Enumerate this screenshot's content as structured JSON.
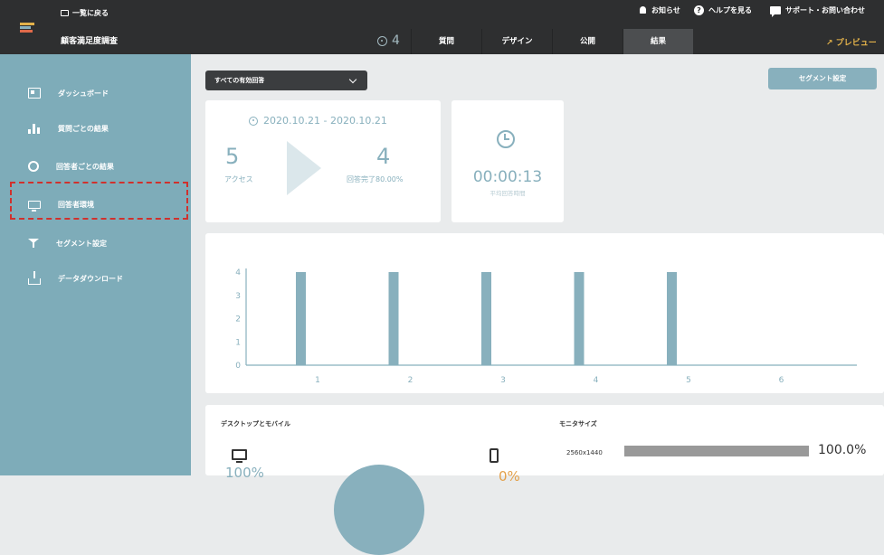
{
  "header": {
    "back_label": "一覧に戻る",
    "survey_title": "顧客満足度調査",
    "response_count": "4",
    "notifications_label": "お知らせ",
    "help_label": "ヘルプを見る",
    "support_label": "サポート・お問い合わせ",
    "tabs": [
      {
        "label": "質問"
      },
      {
        "label": "デザイン"
      },
      {
        "label": "公開"
      },
      {
        "label": "結果",
        "active": true
      }
    ],
    "preview_label": "プレビュー"
  },
  "sidebar": {
    "items": [
      {
        "label": "ダッシュボード",
        "icon": "dashboard-icon"
      },
      {
        "label": "質問ごとの結果",
        "icon": "bar-chart-icon"
      },
      {
        "label": "回答者ごとの結果",
        "icon": "user-icon"
      },
      {
        "label": "回答者環境",
        "icon": "monitor-icon",
        "highlighted": true
      },
      {
        "label": "セグメント設定",
        "icon": "filter-icon"
      },
      {
        "label": "データダウンロード",
        "icon": "download-icon"
      }
    ]
  },
  "filter": {
    "selected": "すべての有効回答"
  },
  "segment_button_label": "セグメント設定",
  "summary": {
    "date_range": "2020.10.21 - 2020.10.21",
    "access_count": "5",
    "access_label": "アクセス",
    "completed_count": "4",
    "completed_label": "回答完了80.00%",
    "avg_time": "00:00:13",
    "avg_time_label": "平均回答時間"
  },
  "chart_data": {
    "type": "bar",
    "categories": [
      "1",
      "2",
      "3",
      "4",
      "5",
      "6"
    ],
    "values": [
      4,
      4,
      4,
      4,
      4,
      0
    ],
    "yticks": [
      "0",
      "1",
      "2",
      "3",
      "4"
    ],
    "ylim": [
      0,
      4
    ],
    "title": "",
    "xlabel": "",
    "ylabel": "",
    "bar_color": "#88b0bd"
  },
  "environment": {
    "device_title": "デスクトップとモバイル",
    "desktop_pct": "100%",
    "mobile_pct": "0%",
    "monitor_title": "モニタサイズ",
    "monitor_rows": [
      {
        "label": "2560x1440",
        "pct": "100.0%",
        "fraction": 1.0
      }
    ]
  },
  "colors": {
    "accent": "#88b0bd",
    "sidebar": "#7eacb9",
    "topbar": "#2e2f30",
    "preview": "#e3b24a",
    "highlight": "#d0312d",
    "mobile": "#e3a04a"
  }
}
